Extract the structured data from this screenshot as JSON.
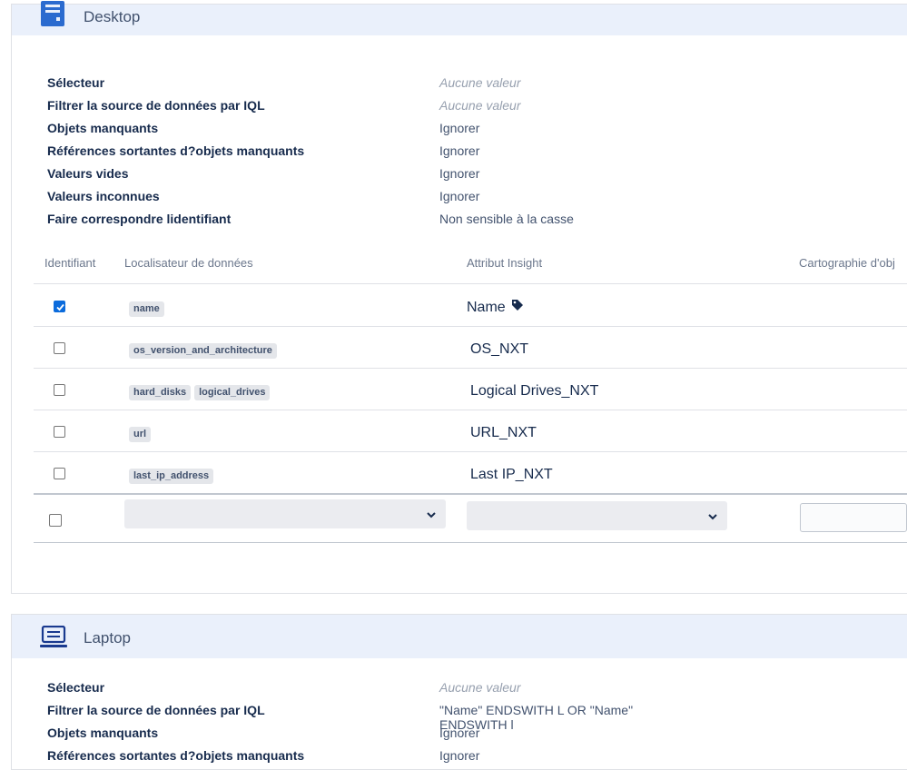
{
  "desktop": {
    "title": "Desktop",
    "properties": [
      {
        "label": "Sélecteur",
        "value": "Aucune valeur",
        "muted": true
      },
      {
        "label": "Filtrer la source de données par IQL",
        "value": "Aucune valeur",
        "muted": true
      },
      {
        "label": "Objets manquants",
        "value": "Ignorer",
        "muted": false
      },
      {
        "label": "Références sortantes d?objets manquants",
        "value": "Ignorer",
        "muted": false
      },
      {
        "label": "Valeurs vides",
        "value": "Ignorer",
        "muted": false
      },
      {
        "label": "Valeurs inconnues",
        "value": "Ignorer",
        "muted": false
      },
      {
        "label": "Faire correspondre lidentifiant",
        "value": "Non sensible à la casse",
        "muted": false
      }
    ],
    "table": {
      "headers": {
        "identifier": "Identifiant",
        "locator": "Localisateur de données",
        "attribute": "Attribut Insight",
        "mapping": "Cartographie d'obj"
      },
      "rows": [
        {
          "checked": true,
          "locators": [
            "name"
          ],
          "attribute": "Name",
          "tag_icon": "tag-icon"
        },
        {
          "checked": false,
          "locators": [
            "os_version_and_architecture"
          ],
          "attribute": "OS_NXT"
        },
        {
          "checked": false,
          "locators": [
            "hard_disks",
            "logical_drives"
          ],
          "attribute": "Logical Drives_NXT"
        },
        {
          "checked": false,
          "locators": [
            "url"
          ],
          "attribute": "URL_NXT"
        },
        {
          "checked": false,
          "locators": [
            "last_ip_address"
          ],
          "attribute": "Last IP_NXT"
        }
      ]
    }
  },
  "laptop": {
    "title": "Laptop",
    "properties": [
      {
        "label": "Sélecteur",
        "value": "Aucune valeur",
        "muted": true
      },
      {
        "label": "Filtrer la source de données par IQL",
        "value": "\"Name\" ENDSWITH L OR \"Name\" ENDSWITH l",
        "muted": false
      },
      {
        "label": "Objets manquants",
        "value": "Ignorer",
        "muted": false
      },
      {
        "label": "Références sortantes d?objets manquants",
        "value": "Ignorer",
        "muted": false
      }
    ]
  },
  "colors": {
    "header_bg": "#eaf0fb",
    "icon_blue": "#2b6bcf",
    "checkbox_blue": "#0b6bdc"
  }
}
